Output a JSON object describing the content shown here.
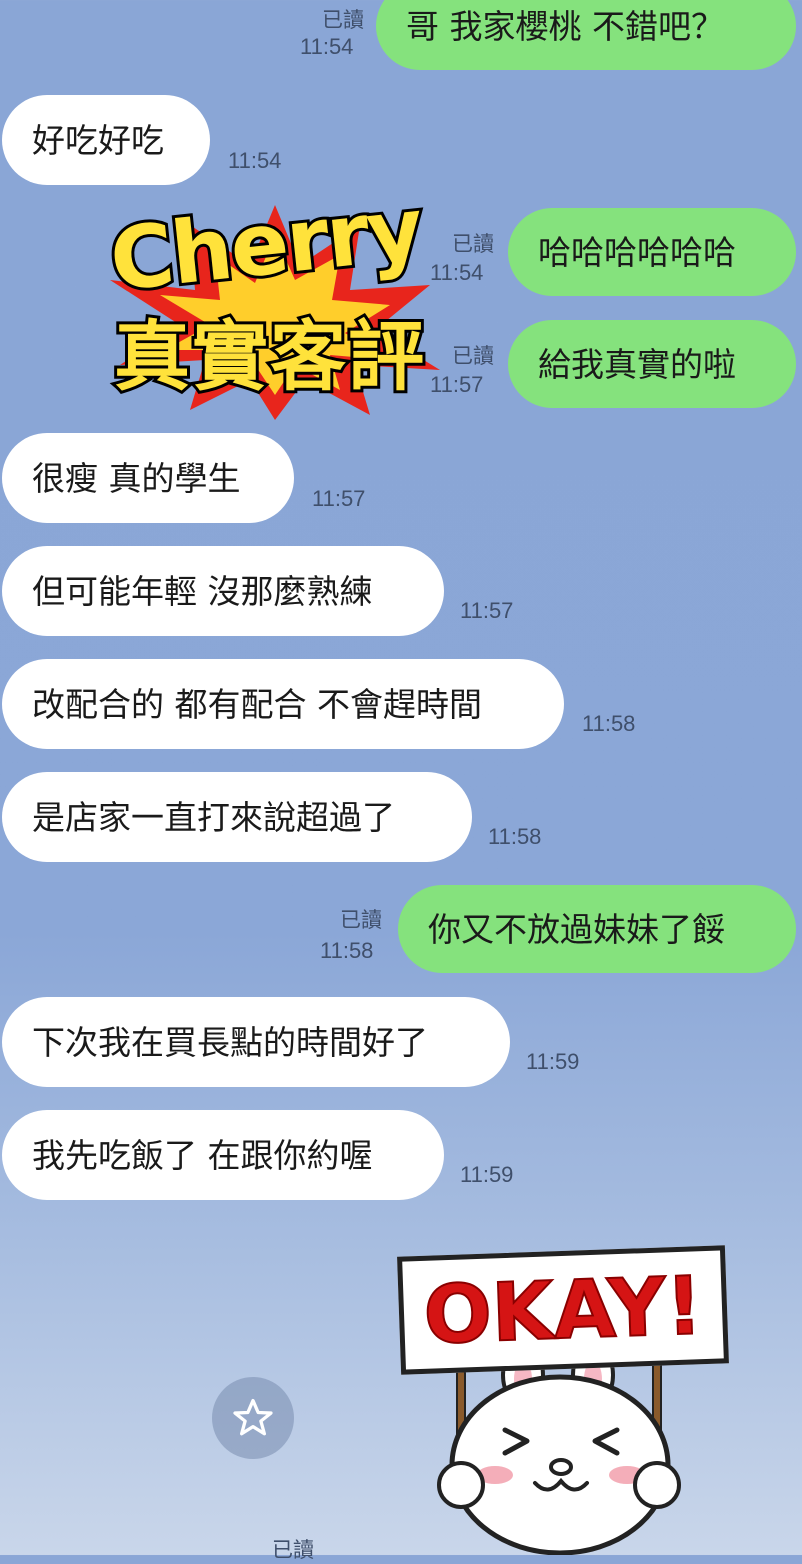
{
  "chat": {
    "read_label": "已讀",
    "messages": [
      {
        "side": "out",
        "text": "哥 我家櫻桃 不錯吧？",
        "time": "11:54"
      },
      {
        "side": "in",
        "text": "好吃好吃",
        "time": "11:54"
      },
      {
        "side": "out",
        "text": "哈哈哈哈哈哈",
        "time": "11:54"
      },
      {
        "side": "out",
        "text": "給我真實的啦",
        "time": "11:57"
      },
      {
        "side": "in",
        "text": "很瘦 真的學生",
        "time": "11:57"
      },
      {
        "side": "in",
        "text": "但可能年輕 沒那麼熟練",
        "time": "11:57"
      },
      {
        "side": "in",
        "text": "改配合的 都有配合 不會趕時間",
        "time": "11:58"
      },
      {
        "side": "in",
        "text": "是店家一直打來說超過了",
        "time": "11:58"
      },
      {
        "side": "out",
        "text": "你又不放過妹妹了餒",
        "time": "11:58"
      },
      {
        "side": "in",
        "text": "下次我在買長點的時間好了",
        "time": "11:59"
      },
      {
        "side": "in",
        "text": "我先吃飯了 在跟你約喔",
        "time": "11:59"
      }
    ]
  },
  "badge": {
    "title_en": "Cherry",
    "title_zh": "真實客評"
  },
  "sticker": {
    "sign_text": "OKAY!"
  },
  "colors": {
    "outgoing": "#85e27d",
    "incoming": "#ffffff",
    "background": "#8aa6d6"
  },
  "icons": {
    "favorite": "star-icon"
  }
}
